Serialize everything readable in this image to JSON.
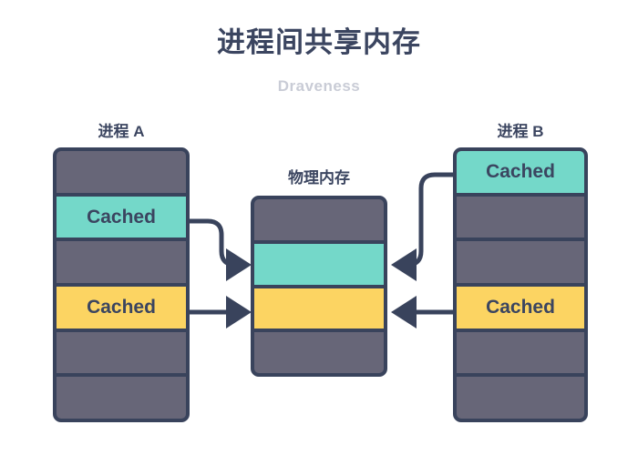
{
  "header": {
    "title": "进程间共享内存",
    "subtitle": "Draveness"
  },
  "colors": {
    "stroke": "#39435c",
    "gray": "#676678",
    "teal": "#74d8c9",
    "yellow": "#fcd462",
    "text": "#3b4560",
    "subtitle": "#c9ccd6",
    "background": "#ffffff"
  },
  "columns": {
    "process_a": {
      "label": "进程 A",
      "cells": [
        {
          "type": "gray",
          "label": ""
        },
        {
          "type": "teal",
          "label": "Cached"
        },
        {
          "type": "gray",
          "label": ""
        },
        {
          "type": "yellow",
          "label": "Cached"
        },
        {
          "type": "gray",
          "label": ""
        },
        {
          "type": "gray",
          "label": ""
        }
      ]
    },
    "physical_memory": {
      "label": "物理内存",
      "cells": [
        {
          "type": "gray",
          "label": ""
        },
        {
          "type": "teal",
          "label": ""
        },
        {
          "type": "yellow",
          "label": ""
        },
        {
          "type": "gray",
          "label": ""
        }
      ]
    },
    "process_b": {
      "label": "进程 B",
      "cells": [
        {
          "type": "teal",
          "label": "Cached"
        },
        {
          "type": "gray",
          "label": ""
        },
        {
          "type": "gray",
          "label": ""
        },
        {
          "type": "yellow",
          "label": "Cached"
        },
        {
          "type": "gray",
          "label": ""
        },
        {
          "type": "gray",
          "label": ""
        }
      ]
    }
  },
  "connectors": [
    {
      "name": "a-teal-to-physical-teal",
      "from": "process_a.cells.1",
      "to": "physical_memory.cells.1",
      "direction": "right"
    },
    {
      "name": "a-yellow-to-physical-yellow",
      "from": "process_a.cells.3",
      "to": "physical_memory.cells.2",
      "direction": "right"
    },
    {
      "name": "b-teal-to-physical-teal",
      "from": "process_b.cells.0",
      "to": "physical_memory.cells.1",
      "direction": "left"
    },
    {
      "name": "b-yellow-to-physical-yellow",
      "from": "process_b.cells.3",
      "to": "physical_memory.cells.2",
      "direction": "left"
    }
  ]
}
